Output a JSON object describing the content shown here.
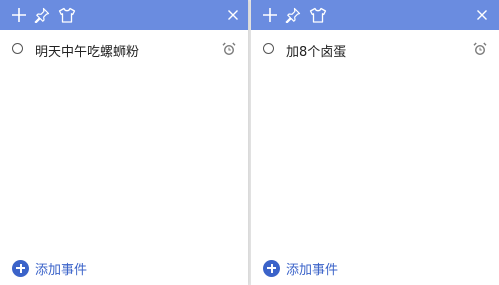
{
  "colors": {
    "titlebar": "#6a8ce0",
    "accent": "#3b63c9",
    "background": "#ffffff"
  },
  "notes": [
    {
      "toolbar": {
        "icons": [
          "plus-icon",
          "pin-icon",
          "shirt-icon",
          "close-icon"
        ]
      },
      "tasks": [
        {
          "text": "明天中午吃螺蛳粉",
          "icon": "alarm-icon"
        }
      ],
      "add_label": "添加事件"
    },
    {
      "toolbar": {
        "icons": [
          "plus-icon",
          "pin-icon",
          "shirt-icon",
          "close-icon"
        ]
      },
      "tasks": [
        {
          "text": "加8个卤蛋",
          "icon": "alarm-icon"
        }
      ],
      "add_label": "添加事件"
    }
  ]
}
